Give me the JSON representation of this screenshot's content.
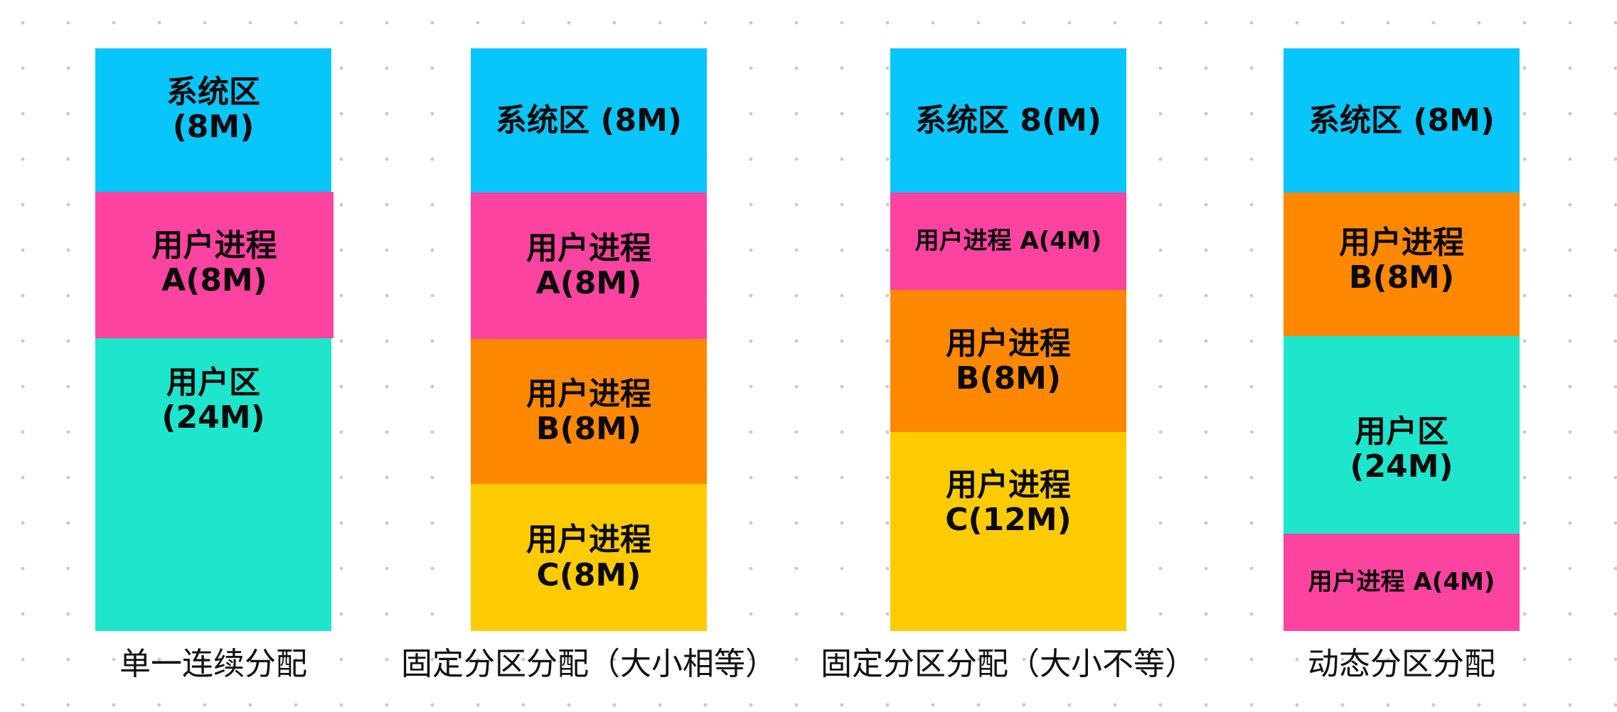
{
  "colors": {
    "system": "#08c5fa",
    "process_a": "#fd43a0",
    "process_b": "#ff8802",
    "process_c": "#fecb02",
    "user_area": "#1de6cd"
  },
  "columns": [
    {
      "caption": "单一连续分配",
      "blocks": [
        {
          "label": "系统区\n(8M)",
          "color": "system"
        },
        {
          "label": "用户进程\nA(8M)",
          "color": "process_a"
        },
        {
          "label": "用户区\n(24M)",
          "color": "user_area"
        }
      ]
    },
    {
      "caption": "固定分区分配（大小相等）",
      "blocks": [
        {
          "label": "系统区 (8M)",
          "color": "system"
        },
        {
          "label": "用户进程\nA(8M)",
          "color": "process_a"
        },
        {
          "label": "用户进程\nB(8M)",
          "color": "process_b"
        },
        {
          "label": "用户进程\nC(8M)",
          "color": "process_c"
        }
      ]
    },
    {
      "caption": "固定分区分配（大小不等）",
      "blocks": [
        {
          "label": "系统区 8(M)",
          "color": "system"
        },
        {
          "label": "用户进程 A(4M)",
          "color": "process_a"
        },
        {
          "label": "用户进程\nB(8M)",
          "color": "process_b"
        },
        {
          "label": "用户进程\nC(12M)",
          "color": "process_c"
        }
      ]
    },
    {
      "caption": "动态分区分配",
      "blocks": [
        {
          "label": "系统区 (8M)",
          "color": "system"
        },
        {
          "label": "用户进程\nB(8M)",
          "color": "process_b"
        },
        {
          "label": "用户区\n(24M)",
          "color": "user_area"
        },
        {
          "label": "用户进程 A(4M)",
          "color": "process_a"
        }
      ]
    }
  ]
}
